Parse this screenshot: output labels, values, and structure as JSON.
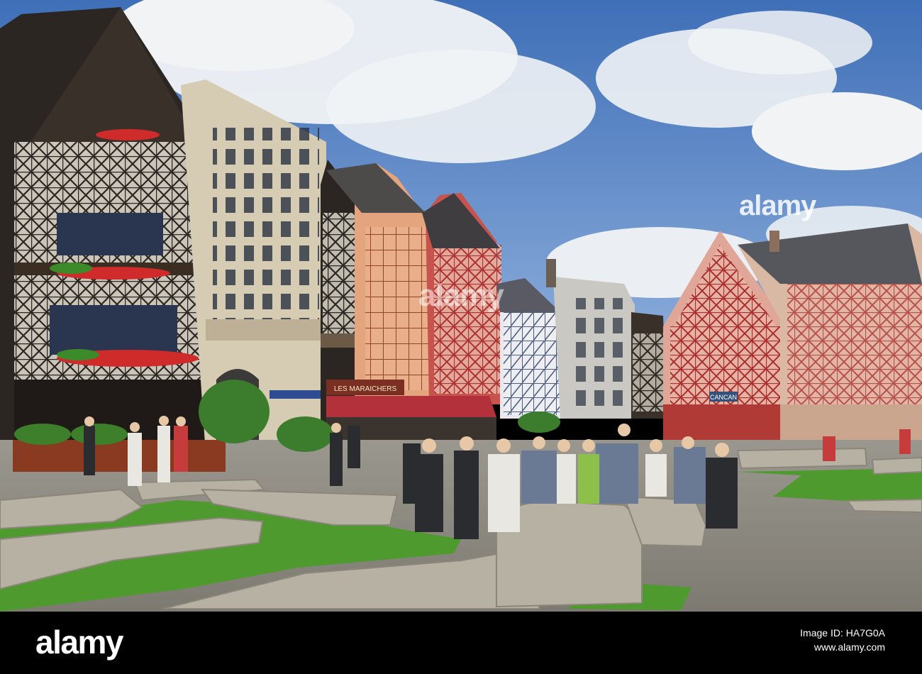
{
  "photo": {
    "description_label": "",
    "watermark_center": "alamy",
    "watermark_top": "alamy",
    "colors": {
      "sky": "#5b86c9",
      "cloud": "#f1f3f5",
      "grass": "#4e9a2e",
      "stone": "#b6b1a2",
      "gravel": "#8c8a84",
      "timber_dark": "#2b2622",
      "plaster_pink": "#e0a799",
      "plaster_cream": "#d8cdb5"
    }
  },
  "signs": {
    "les_maraichers": "LES MARAICHERS",
    "cancan": "CANCAN"
  },
  "footer": {
    "logo": "alamy",
    "image_id_label": "Image ID: HA7G0A",
    "site": "www.alamy.com"
  }
}
